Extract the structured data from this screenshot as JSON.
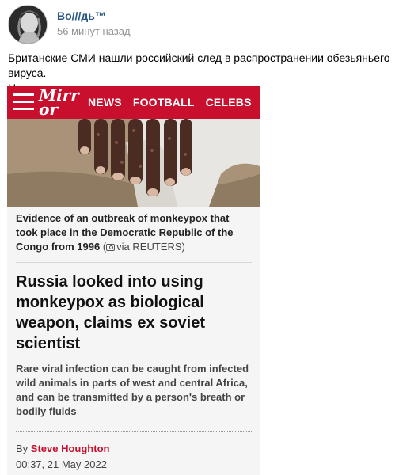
{
  "post": {
    "author": "Во///дь™",
    "time": "56 минут назад",
    "text_line1": "Британские СМИ нашли российский след в распространении обезьяньего вируса.",
    "text_line2": "Ну наконец-то, а то уж думал теряем хватку"
  },
  "article": {
    "logo_line1": "Mirr",
    "logo_line2": "or",
    "nav": [
      "NEWS",
      "FOOTBALL",
      "CELEBS"
    ],
    "caption_main": "Evidence of an outbreak of monkeypox that took place in the Democratic Republic of the Congo from 1996",
    "caption_credit": "via REUTERS)",
    "headline": "Russia looked into using monkeypox as biological weapon, claims ex soviet scientist",
    "standfirst": "Rare viral infection can be caught from infected wild animals in parts of west and central Africa, and can be transmitted by a person's breath or bodily fluids",
    "by_label": "By",
    "author": "Steve Houghton",
    "date": "00:37, 21 May 2022"
  },
  "colors": {
    "brand": "#c8102e",
    "link": "#2a5885",
    "muted": "#939393"
  },
  "icons": [
    "avatar",
    "burger-menu-icon",
    "camera-icon"
  ]
}
